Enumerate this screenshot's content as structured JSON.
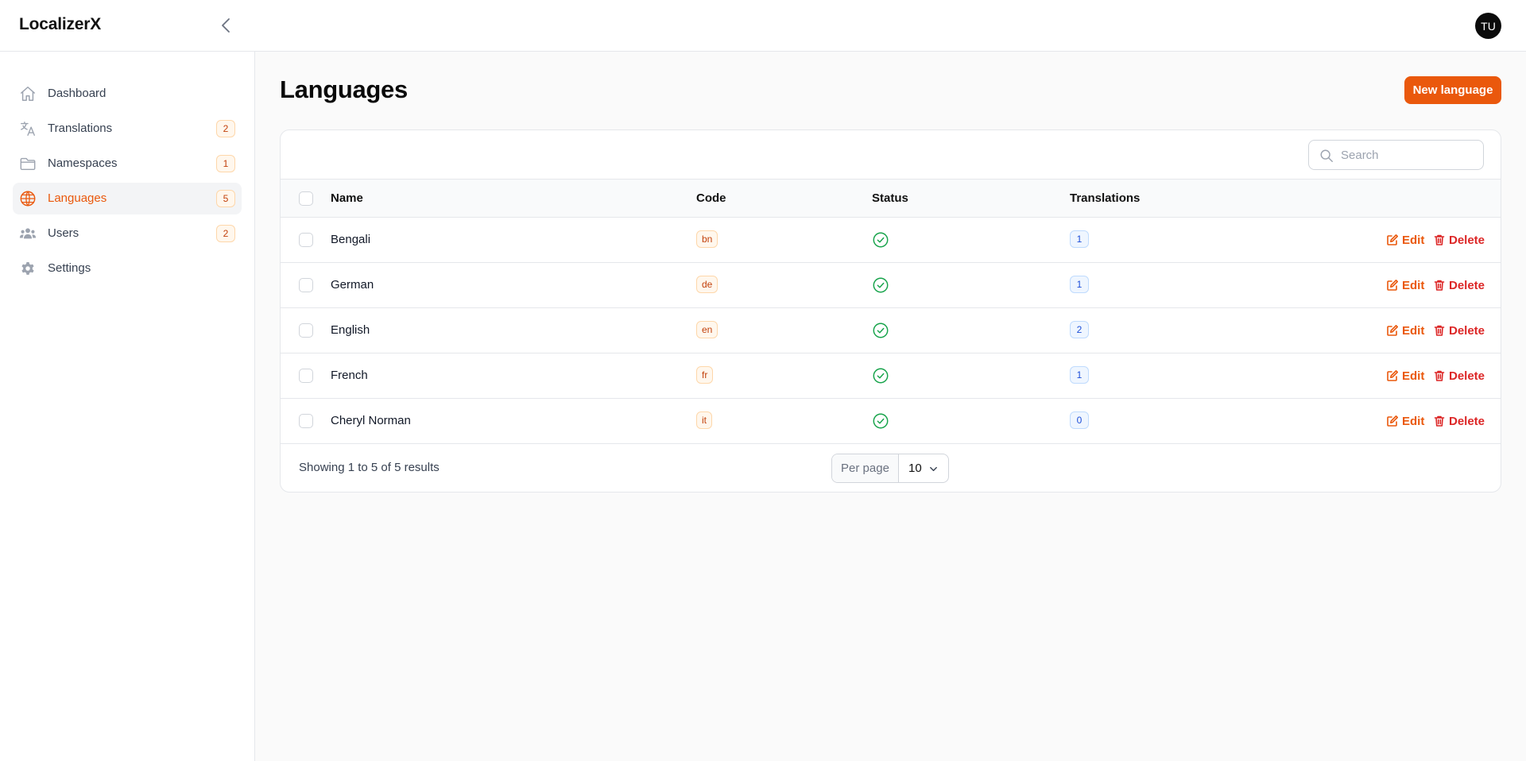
{
  "app": {
    "brand": "LocalizerX",
    "avatar_initials": "TU"
  },
  "sidebar": {
    "items": [
      {
        "label": "Dashboard",
        "icon": "home-icon",
        "badge": ""
      },
      {
        "label": "Translations",
        "icon": "translate-icon",
        "badge": "2"
      },
      {
        "label": "Namespaces",
        "icon": "folder-icon",
        "badge": "1"
      },
      {
        "label": "Languages",
        "icon": "globe-icon",
        "badge": "5",
        "active": true
      },
      {
        "label": "Users",
        "icon": "users-icon",
        "badge": "2"
      },
      {
        "label": "Settings",
        "icon": "gear-icon",
        "badge": ""
      }
    ]
  },
  "page": {
    "title": "Languages",
    "new_button": "New language"
  },
  "search": {
    "placeholder": "Search",
    "value": ""
  },
  "table": {
    "columns": [
      "Name",
      "Code",
      "Status",
      "Translations"
    ],
    "rows": [
      {
        "name": "Bengali",
        "code": "bn",
        "status": "active",
        "translations": "1"
      },
      {
        "name": "German",
        "code": "de",
        "status": "active",
        "translations": "1"
      },
      {
        "name": "English",
        "code": "en",
        "status": "active",
        "translations": "2"
      },
      {
        "name": "French",
        "code": "fr",
        "status": "active",
        "translations": "1"
      },
      {
        "name": "Cheryl Norman",
        "code": "it",
        "status": "active",
        "translations": "0"
      }
    ],
    "actions": {
      "edit": "Edit",
      "delete": "Delete"
    }
  },
  "pagination": {
    "summary": "Showing 1 to 5 of 5 results",
    "per_page_label": "Per page",
    "per_page_value": "10"
  },
  "colors": {
    "accent": "#ea580c",
    "danger": "#dc2626",
    "success": "#16a34a",
    "info": "#1d4ed8"
  }
}
